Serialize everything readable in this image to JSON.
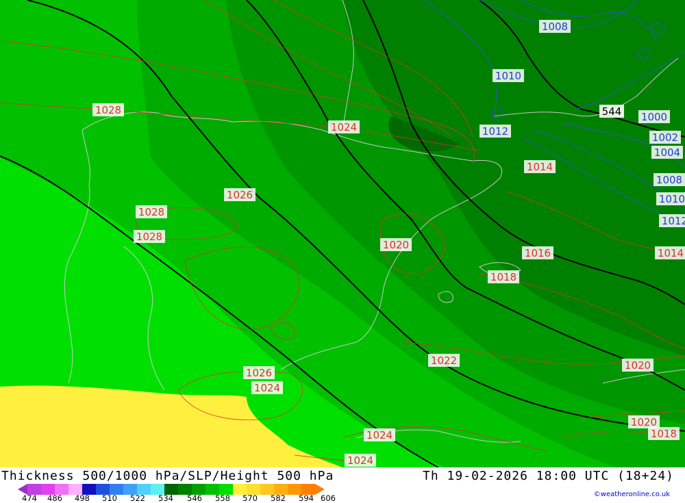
{
  "title": "Thickness 500/1000 hPa/SLP/Height 500 hPa",
  "valid_time": "Th 19-02-2026 18:00 UTC (18+24)",
  "credit": "©weatheronline.co.uk",
  "legend": {
    "labels": [
      "474",
      "486",
      "498",
      "510",
      "522",
      "534",
      "546",
      "558",
      "570",
      "582",
      "594",
      "606"
    ],
    "colors": [
      "#9b30c8",
      "#c040e0",
      "#e040f0",
      "#f070f8",
      "#ffb0ff",
      "#1010c0",
      "#2050e0",
      "#3080f0",
      "#40a0f8",
      "#50d0ff",
      "#60f0f0",
      "#006400",
      "#008000",
      "#00a000",
      "#00c000",
      "#00e000",
      "#fff040",
      "#ffe030",
      "#ffc820",
      "#ffb010",
      "#ff9800",
      "#ff8000"
    ]
  },
  "contours": {
    "slp_red": [
      "1028",
      "1024",
      "1026",
      "1028",
      "1028",
      "1020",
      "1014",
      "1016",
      "1018",
      "1022",
      "1020",
      "1026",
      "1024",
      "1024",
      "1024",
      "1020",
      "1018"
    ],
    "slp_blue": [
      "1008",
      "1010",
      "1012",
      "1000",
      "1002",
      "1004",
      "1008",
      "1010",
      "1012",
      "1014"
    ],
    "height_black": [
      "544"
    ]
  }
}
